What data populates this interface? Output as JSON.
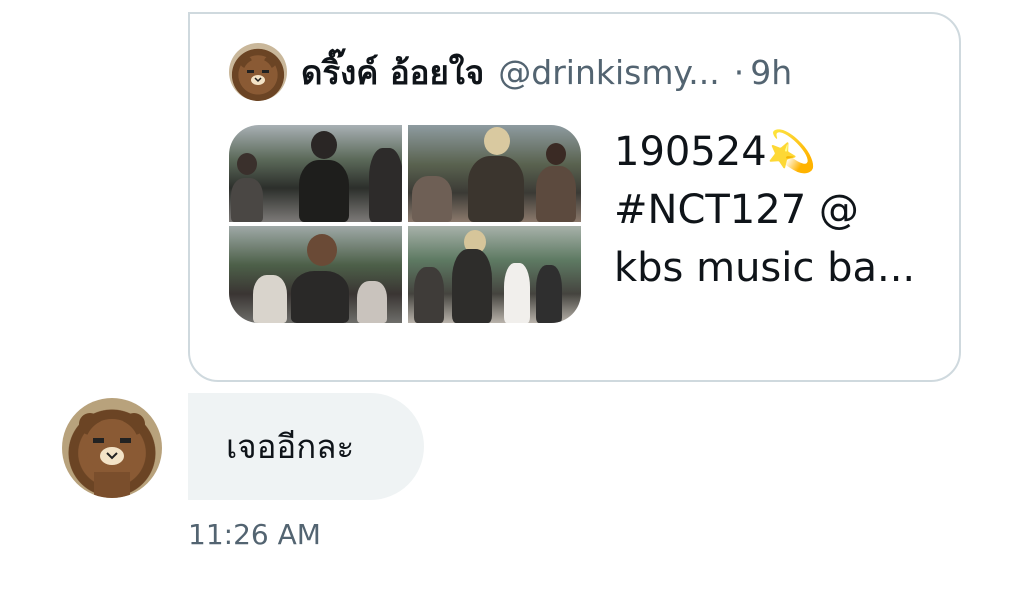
{
  "quoted_tweet": {
    "display_name": "ดริ๊งค์ อ้อยใจ",
    "handle": "@drinkismy...",
    "dot": "·",
    "time_ago": "9h",
    "text_lines": [
      "190524💫",
      "#NCT127 @",
      "kbs music ba..."
    ],
    "media_count": 4
  },
  "message": {
    "text": "เจออีกละ",
    "timestamp": "11:26 AM"
  },
  "colors": {
    "border": "#cfd9de",
    "bubble_bg": "#eff3f4",
    "secondary_text": "#536471",
    "primary_text": "#0f1419"
  },
  "icons": {
    "sender_avatar": "brown-bear-avatar-icon",
    "author_avatar": "brown-bear-avatar-icon",
    "sparkle": "dizzy-star-emoji"
  }
}
